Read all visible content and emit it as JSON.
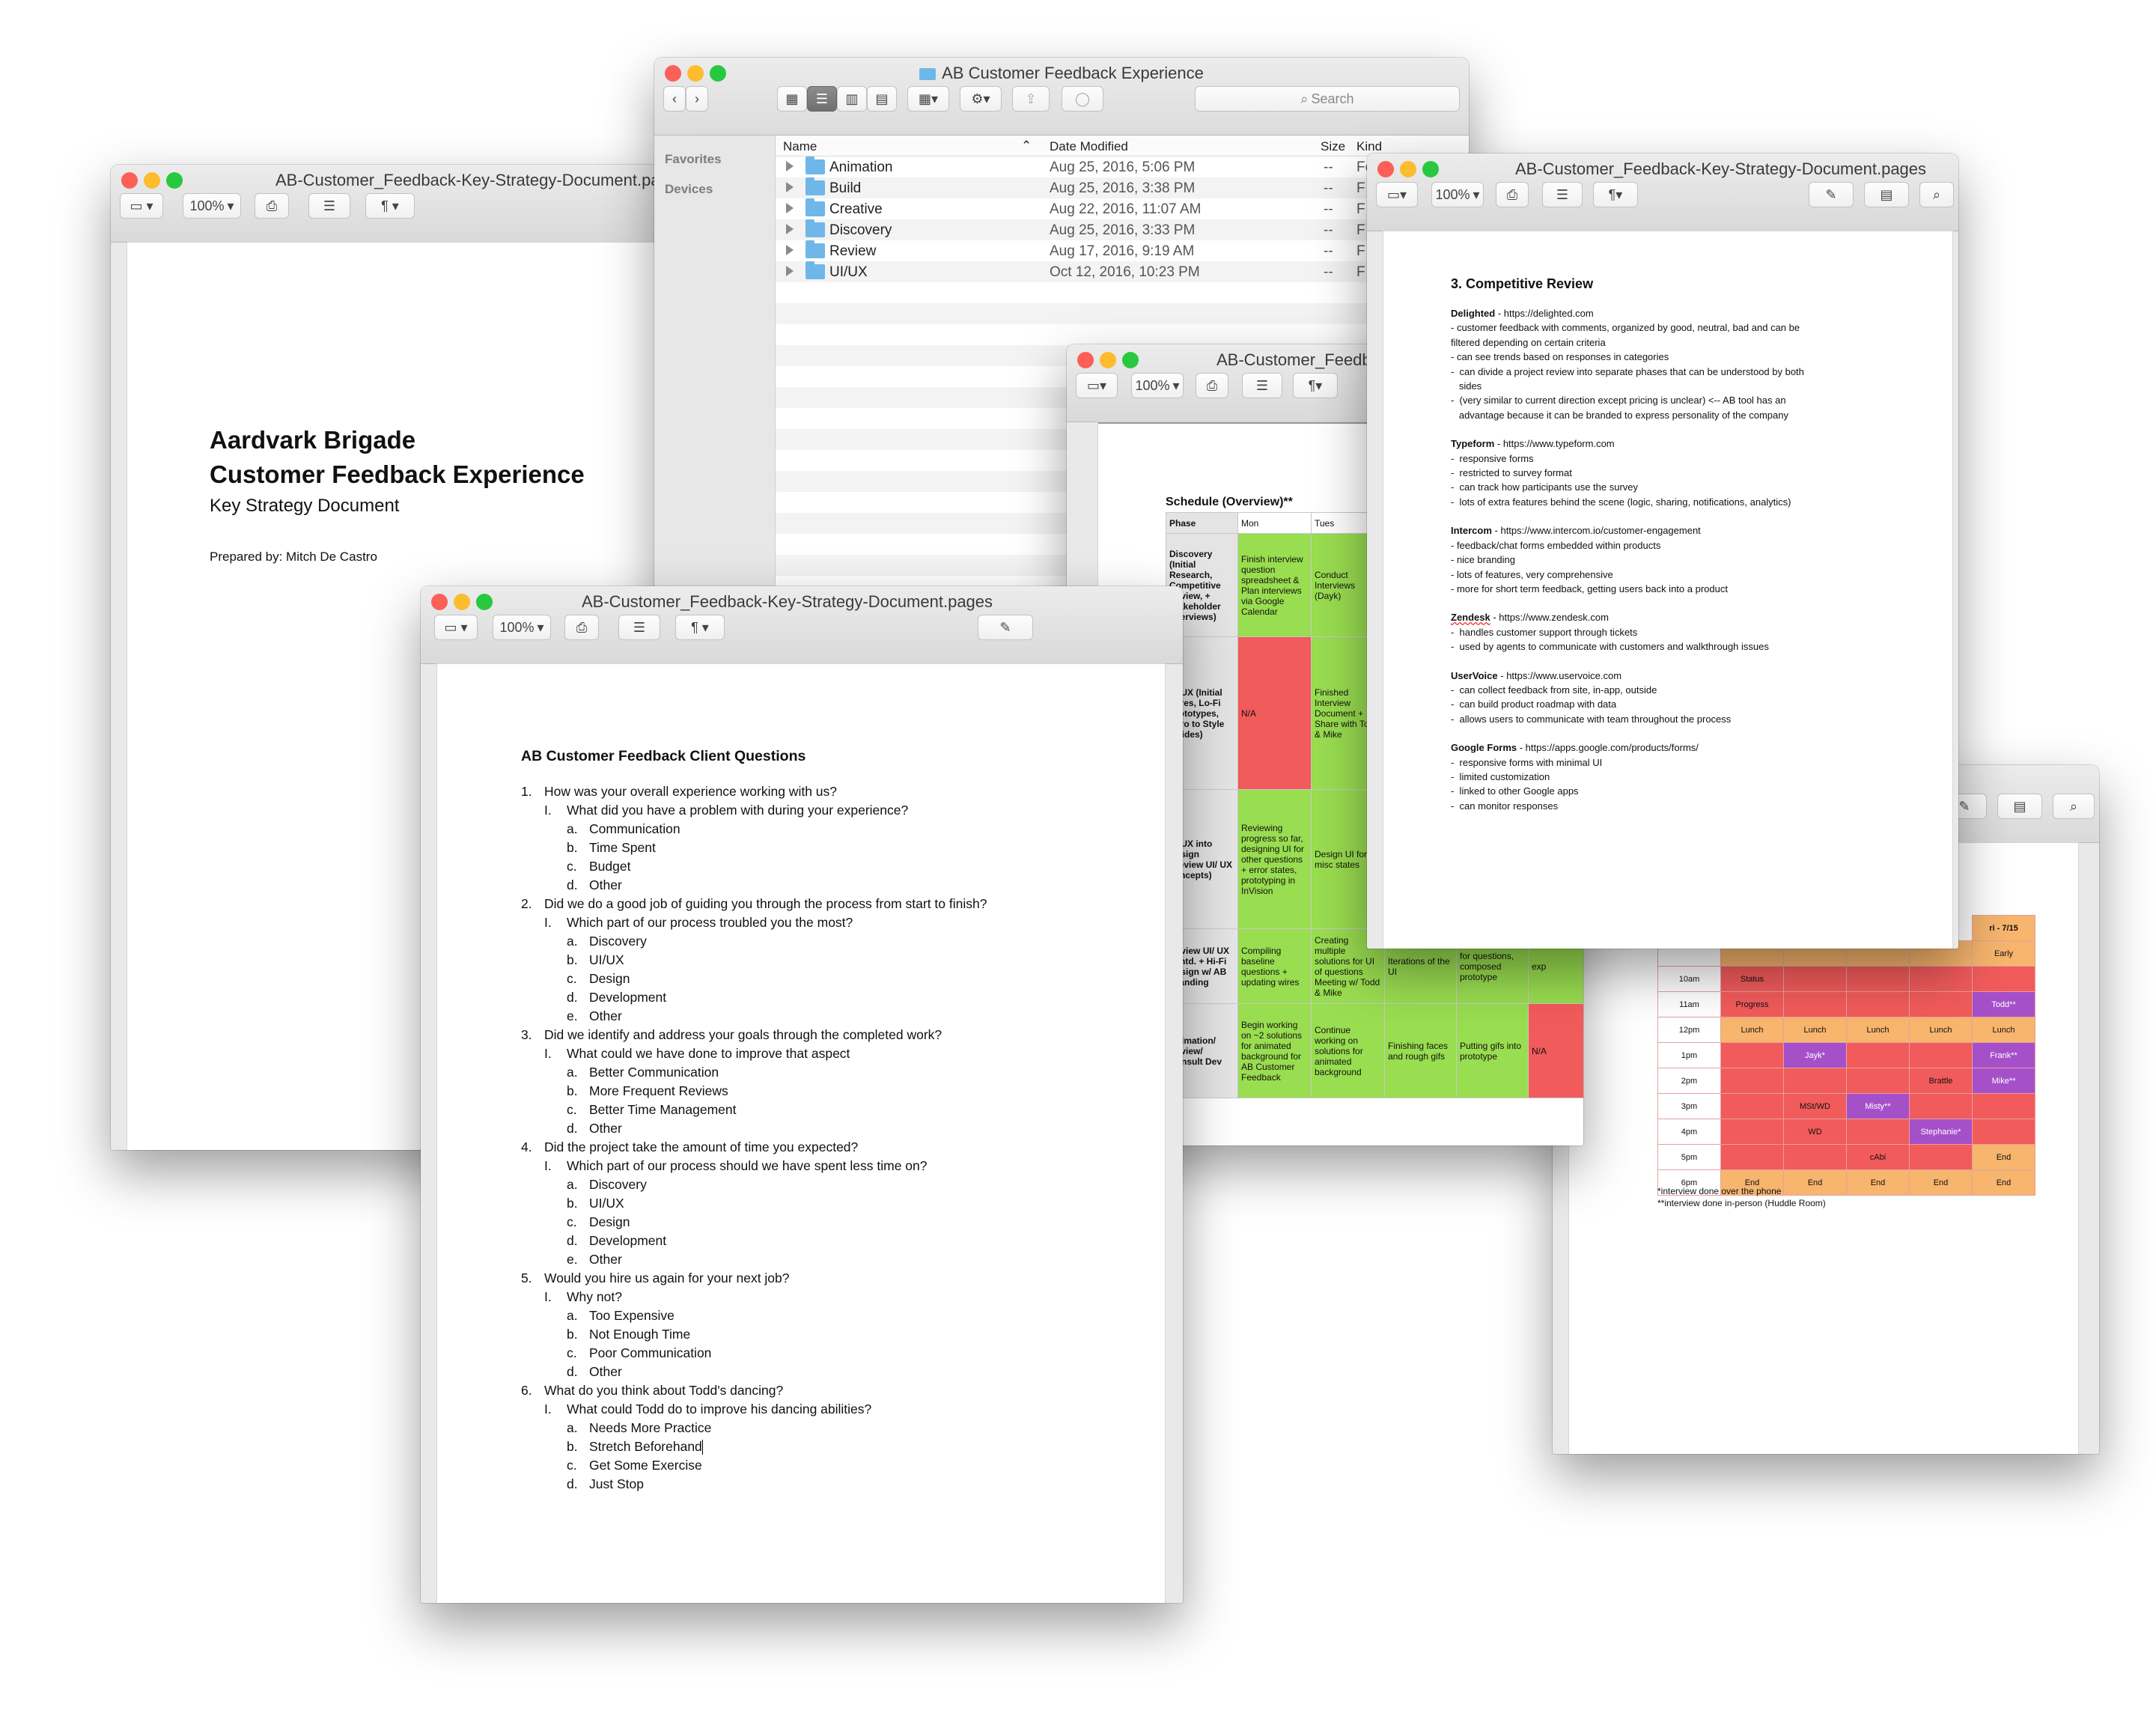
{
  "common": {
    "zoom": "100%",
    "search": "Search"
  },
  "cover": {
    "title": "AB-Customer_Feedback-Key-Strategy-Document.pa",
    "h1": "Aardvark Brigade",
    "h2": "Customer Feedback Experience",
    "h3": "Key Strategy Document",
    "prepared": "Prepared by: Mitch De Castro"
  },
  "finder": {
    "title": "AB Customer Feedback Experience",
    "sidebar": [
      "Favorites",
      "Devices"
    ],
    "columns": {
      "name": "Name",
      "date": "Date Modified",
      "size": "Size",
      "kind": "Kind"
    },
    "rows": [
      {
        "name": "Animation",
        "date": "Aug 25, 2016, 5:06 PM",
        "size": "--",
        "kind": "Folder"
      },
      {
        "name": "Build",
        "date": "Aug 25, 2016, 3:38 PM",
        "size": "--",
        "kind": "F"
      },
      {
        "name": "Creative",
        "date": "Aug 22, 2016, 11:07 AM",
        "size": "--",
        "kind": "F"
      },
      {
        "name": "Discovery",
        "date": "Aug 25, 2016, 3:33 PM",
        "size": "--",
        "kind": "F"
      },
      {
        "name": "Review",
        "date": "Aug 17, 2016, 9:19 AM",
        "size": "--",
        "kind": "F"
      },
      {
        "name": "UI/UX",
        "date": "Oct 12, 2016, 10:23 PM",
        "size": "--",
        "kind": "F"
      }
    ]
  },
  "questions": {
    "title": "AB-Customer_Feedback-Key-Strategy-Document.pages",
    "heading": "AB Customer Feedback Client Questions",
    "items": [
      {
        "n": "1.",
        "q": "How was your overall experience working with us?",
        "sq": "What did you have a problem with during your experience?",
        "opts": [
          "Communication",
          "Time Spent",
          "Budget",
          "Other"
        ]
      },
      {
        "n": "2.",
        "q": "Did we do a good job of guiding you through the process from start to finish?",
        "sq": "Which part of our process troubled you the most?",
        "opts": [
          "Discovery",
          "UI/UX",
          "Design",
          "Development",
          "Other"
        ]
      },
      {
        "n": "3.",
        "q": "Did we identify and address your goals through the completed work?",
        "sq": "What could we have done to improve that aspect",
        "opts": [
          "Better Communication",
          "More Frequent Reviews",
          "Better Time Management",
          "Other"
        ]
      },
      {
        "n": "4.",
        "q": "Did the project take the amount of time you expected?",
        "sq": "Which part of our process should we have spent less time on?",
        "opts": [
          "Discovery",
          "UI/UX",
          "Design",
          "Development",
          "Other"
        ]
      },
      {
        "n": "5.",
        "q": "Would you hire us again for your next job?",
        "sq": "Why not?",
        "opts": [
          "Too Expensive",
          "Not Enough Time",
          "Poor Communication",
          "Other"
        ]
      },
      {
        "n": "6.",
        "q": "What do you think about Todd's dancing?",
        "sq": "What could Todd do to improve his dancing abilities?",
        "opts": [
          "Needs More Practice",
          "Stretch Beforehand",
          "Get Some Exercise",
          "Just Stop"
        ]
      }
    ]
  },
  "schedule": {
    "title": "AB-Customer_Feedbac",
    "heading": "Schedule (Overview)**",
    "headers": [
      "Phase",
      "Mon",
      "Tues"
    ],
    "rows": [
      {
        "phase": "Discovery (Initial Research, Competitive Review, + Stakeholder Interviews)",
        "mon": "Finish interview question spreadsheet & Plan interviews via Google Calendar",
        "tue": "Conduct Interviews (Dayk)"
      },
      {
        "phase": "UI/UX (Initial Wires, Lo-Fi Prototypes, Intro to Style Guides)",
        "mon": "N/A",
        "tue": "Finished Interview Document + Share with Todd & Mike"
      },
      {
        "phase": "UI/UX into Design (Review UI/ UX concepts)",
        "mon": "Reviewing progress so far, designing UI for other questions + error states, prototyping in InVision",
        "tue": "Design UI for misc states"
      },
      {
        "phase": "Review UI/ UX contd. + Hi-Fi Design w/ AB Branding",
        "mon": "Compiling baseline questions + updating wires",
        "tue": "Creating multiple solutions for UI of questions Meeting w/ Todd & Mike",
        "wed": "Iterations of the UI",
        "thu": "for questions, composed prototype",
        "fri": "exp"
      },
      {
        "phase": "Animation/ Review/ Consult Dev",
        "mon": "Begin working on ~2 solutions for animated background for AB Customer Feedback",
        "tue": "Continue working on solutions for animated background",
        "wed": "Finishing faces and rough gifs",
        "thu": "Putting gifs into prototype",
        "fri": "N/A"
      }
    ]
  },
  "review": {
    "title": "AB-Customer_Feedback-Key-Strategy-Document.pages",
    "heading": "3. Competitive Review",
    "sections": [
      {
        "name": "Delighted",
        "url": " - https://delighted.com",
        "lines": [
          "- customer feedback with comments, organized by good, neutral, bad and can be",
          "filtered depending on certain criteria",
          "- can see trends based on responses in categories",
          "-  can divide a project review into separate phases that can be understood by both",
          "   sides",
          "-  (very similar to current direction except pricing is unclear) <-- AB tool has an",
          "   advantage because it can be branded to express personality of the company"
        ]
      },
      {
        "name": "Typeform",
        "url": " - https://www.typeform.com",
        "lines": [
          "-  responsive forms",
          "-  restricted to survey format",
          "-  can track how participants use the survey",
          "-  lots of extra features behind the scene (logic, sharing, notifications, analytics)"
        ]
      },
      {
        "name": "Intercom",
        "url": " - https://www.intercom.io/customer-engagement",
        "lines": [
          "- feedback/chat forms embedded within products",
          "- nice branding",
          "- lots of features, very comprehensive",
          "- more for short term feedback, getting users back into a product"
        ]
      },
      {
        "name": "Zendesk",
        "url": " - https://www.zendesk.com",
        "lines": [
          "-  handles customer support through tickets",
          "-  used by agents to communicate with customers and walkthrough issues"
        ]
      },
      {
        "name": "UserVoice",
        "url": " - https://www.uservoice.com",
        "lines": [
          "-  can collect feedback from site, in-app, outside",
          "-  can build product roadmap with data",
          "-  allows users to communicate with team throughout the process"
        ]
      },
      {
        "name": "Google Forms",
        "url": " - https://apps.google.com/products/forms/",
        "lines": [
          "-  responsive forms with minimal UI",
          "-  limited customization",
          "-  linked to other Google apps",
          "-  can monitor responses"
        ]
      }
    ]
  },
  "calendar": {
    "header_fri": "ri - 7/15",
    "times": [
      "",
      "10am",
      "11am",
      "12pm",
      "1pm",
      "2pm",
      "3pm",
      "4pm",
      "5pm",
      "6pm"
    ],
    "cells": [
      [
        "",
        "",
        "",
        "",
        "Early"
      ],
      [
        "Status",
        "",
        "",
        "",
        ""
      ],
      [
        "Progress",
        "",
        "",
        "",
        "Todd**"
      ],
      [
        "Lunch",
        "Lunch",
        "Lunch",
        "Lunch",
        "Lunch"
      ],
      [
        "",
        "Jayk*",
        "",
        "",
        "Frank**"
      ],
      [
        "",
        "",
        "",
        "Brattle",
        "Mike**"
      ],
      [
        "",
        "MSt/WD",
        "Misty**",
        "",
        ""
      ],
      [
        "",
        "WD",
        "",
        "Stephanie*",
        ""
      ],
      [
        "",
        "",
        "cAbi",
        "",
        "End"
      ],
      [
        "End",
        "End",
        "End",
        "End",
        "End"
      ]
    ],
    "note1": "*interview done over the phone",
    "note2": "**interview done in-person (Huddle Room)"
  }
}
